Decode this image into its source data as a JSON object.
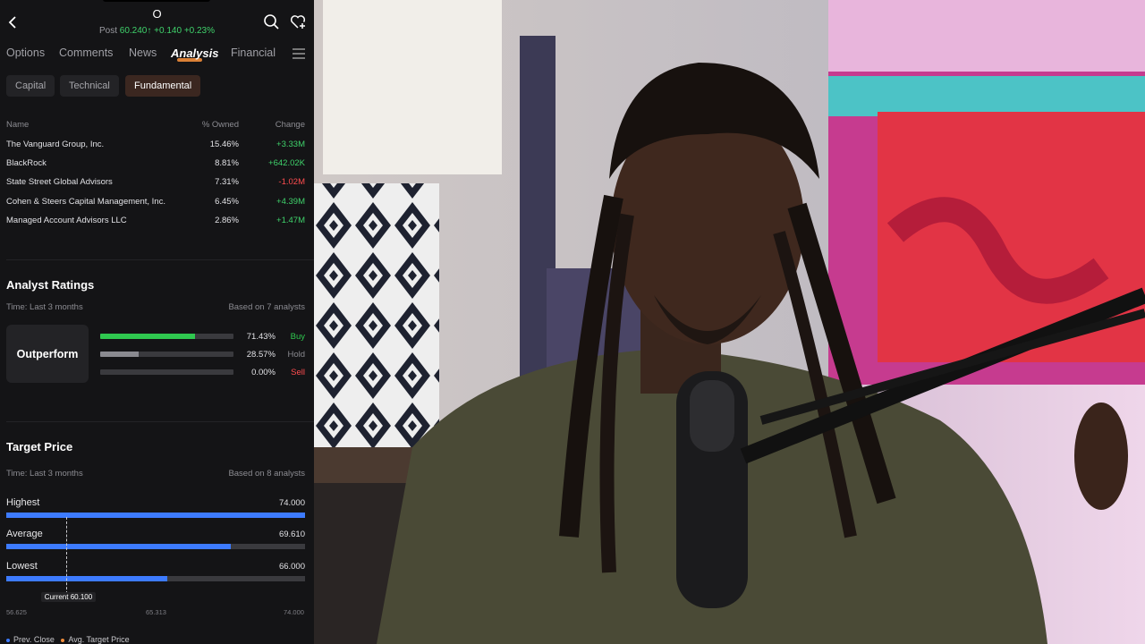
{
  "header": {
    "ticker": "O",
    "post_label": "Post",
    "post_price": "60.240",
    "post_change": "+0.140",
    "post_change_pct": "+0.23%"
  },
  "tabs": [
    {
      "label": "Options"
    },
    {
      "label": "Comments"
    },
    {
      "label": "News"
    },
    {
      "label": "Analysis",
      "active": true
    },
    {
      "label": "Financial"
    }
  ],
  "subtabs": [
    {
      "label": "Capital"
    },
    {
      "label": "Technical"
    },
    {
      "label": "Fundamental",
      "active": true
    }
  ],
  "holders": {
    "columns": [
      "Name",
      "% Owned",
      "Change"
    ],
    "rows": [
      {
        "name": "The Vanguard Group, Inc.",
        "owned": "15.46%",
        "change": "+3.33M"
      },
      {
        "name": "BlackRock",
        "owned": "8.81%",
        "change": "+642.02K"
      },
      {
        "name": "State Street Global Advisors",
        "owned": "7.31%",
        "change": "-1.02M"
      },
      {
        "name": "Cohen & Steers Capital Management, Inc.",
        "owned": "6.45%",
        "change": "+4.39M"
      },
      {
        "name": "Managed Account Advisors LLC",
        "owned": "2.86%",
        "change": "+1.47M"
      }
    ]
  },
  "analyst_ratings": {
    "title": "Analyst Ratings",
    "time": "Time: Last 3 months",
    "based_on": "Based on 7 analysts",
    "consensus": "Outperform",
    "ratings": [
      {
        "label": "Buy",
        "pct": "71.43%",
        "fraction": 0.7143,
        "color": "#2fc84f"
      },
      {
        "label": "Hold",
        "pct": "28.57%",
        "fraction": 0.2857,
        "color": "#8a8a90"
      },
      {
        "label": "Sell",
        "pct": "0.00%",
        "fraction": 0.0,
        "color": "#ff4d4f"
      }
    ]
  },
  "target_price": {
    "title": "Target Price",
    "time": "Time: Last 3 months",
    "based_on": "Based on 8 analysts",
    "rows": [
      {
        "label": "Highest",
        "value": "74.000",
        "fraction": 1.0
      },
      {
        "label": "Average",
        "value": "69.610",
        "fraction": 0.75
      },
      {
        "label": "Lowest",
        "value": "66.000",
        "fraction": 0.54
      }
    ],
    "current_label": "Current 60.100",
    "current_fraction": 0.2,
    "axis_ticks": [
      "56.625",
      "65.313",
      "74.000"
    ],
    "legend": [
      {
        "label": "Prev. Close",
        "color": "#3d7bff"
      },
      {
        "label": "Avg. Target Price",
        "color": "#f08c3a"
      }
    ]
  },
  "colors": {
    "accent": "#f08c3a",
    "up": "#3fd26b",
    "down": "#ff4d4f",
    "bar_blue": "#3d7bff",
    "panel_bg": "#141416"
  },
  "icons": [
    "back-icon",
    "search-icon",
    "watchlist-heart-icon",
    "menu-icon"
  ]
}
